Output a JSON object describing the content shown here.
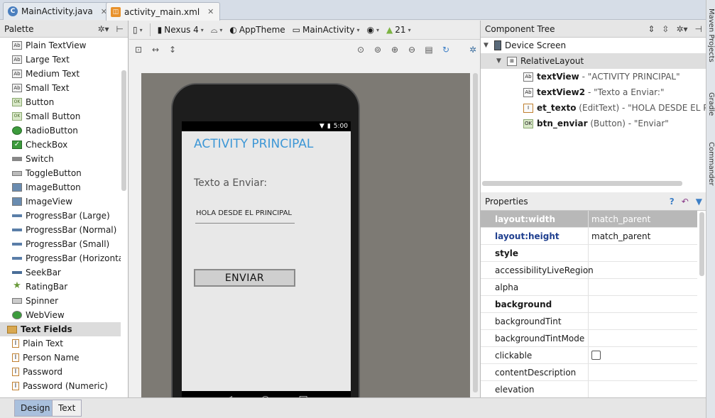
{
  "tabs": [
    {
      "label": "MainActivity.java",
      "icon": "java-class-icon"
    },
    {
      "label": "activity_main.xml",
      "icon": "xml-layout-icon"
    }
  ],
  "palette": {
    "title": "Palette",
    "items": [
      {
        "label": "Plain TextView",
        "icon": "Ab"
      },
      {
        "label": "Large Text",
        "icon": "Ab"
      },
      {
        "label": "Medium Text",
        "icon": "Ab"
      },
      {
        "label": "Small Text",
        "icon": "Ab"
      },
      {
        "label": "Button",
        "icon": "OK"
      },
      {
        "label": "Small Button",
        "icon": "OK"
      },
      {
        "label": "RadioButton",
        "icon": "radio"
      },
      {
        "label": "CheckBox",
        "icon": "check"
      },
      {
        "label": "Switch",
        "icon": "switch"
      },
      {
        "label": "ToggleButton",
        "icon": "toggle"
      },
      {
        "label": "ImageButton",
        "icon": "image"
      },
      {
        "label": "ImageView",
        "icon": "image"
      },
      {
        "label": "ProgressBar (Large)",
        "icon": "bar"
      },
      {
        "label": "ProgressBar (Normal)",
        "icon": "bar"
      },
      {
        "label": "ProgressBar (Small)",
        "icon": "bar"
      },
      {
        "label": "ProgressBar (Horizontal)",
        "icon": "bar"
      },
      {
        "label": "SeekBar",
        "icon": "seek"
      },
      {
        "label": "RatingBar",
        "icon": "star"
      },
      {
        "label": "Spinner",
        "icon": "spinner"
      },
      {
        "label": "WebView",
        "icon": "web"
      }
    ],
    "category": "Text Fields",
    "text_fields": [
      {
        "label": "Plain Text"
      },
      {
        "label": "Person Name"
      },
      {
        "label": "Password"
      },
      {
        "label": "Password (Numeric)"
      }
    ]
  },
  "toolbar": {
    "device": "Nexus 4",
    "theme": "AppTheme",
    "activity": "MainActivity",
    "api": "21"
  },
  "preview": {
    "time": "5:00",
    "title": "ACTIVITY PRINCIPAL",
    "label": "Texto a Enviar:",
    "edit_text": "HOLA DESDE EL PRINCIPAL",
    "button": "ENVIAR"
  },
  "component_tree": {
    "title": "Component Tree",
    "root": "Device Screen",
    "layout": "RelativeLayout",
    "children": [
      {
        "id": "textView",
        "desc": " - \"ACTIVITY PRINCIPAL\"",
        "icon": "Ab"
      },
      {
        "id": "textView2",
        "desc": " - \"Texto a Enviar:\"",
        "icon": "Ab"
      },
      {
        "id": "et_texto",
        "desc": " (EditText) - \"HOLA DESDE EL PRINCIPAL\"",
        "icon": "I"
      },
      {
        "id": "btn_enviar",
        "desc": " (Button) - \"Enviar\"",
        "icon": "OK"
      }
    ]
  },
  "properties": {
    "title": "Properties",
    "rows": [
      {
        "key": "layout:width",
        "value": "match_parent"
      },
      {
        "key": "layout:height",
        "value": "match_parent"
      },
      {
        "key": "style",
        "value": ""
      },
      {
        "key": "accessibilityLiveRegion",
        "value": ""
      },
      {
        "key": "alpha",
        "value": ""
      },
      {
        "key": "background",
        "value": ""
      },
      {
        "key": "backgroundTint",
        "value": ""
      },
      {
        "key": "backgroundTintMode",
        "value": ""
      },
      {
        "key": "clickable",
        "value": ""
      },
      {
        "key": "contentDescription",
        "value": ""
      },
      {
        "key": "elevation",
        "value": ""
      }
    ]
  },
  "side_tools": [
    "Maven Projects",
    "Gradle",
    "Commander"
  ],
  "bottom_tabs": [
    "Design",
    "Text"
  ]
}
